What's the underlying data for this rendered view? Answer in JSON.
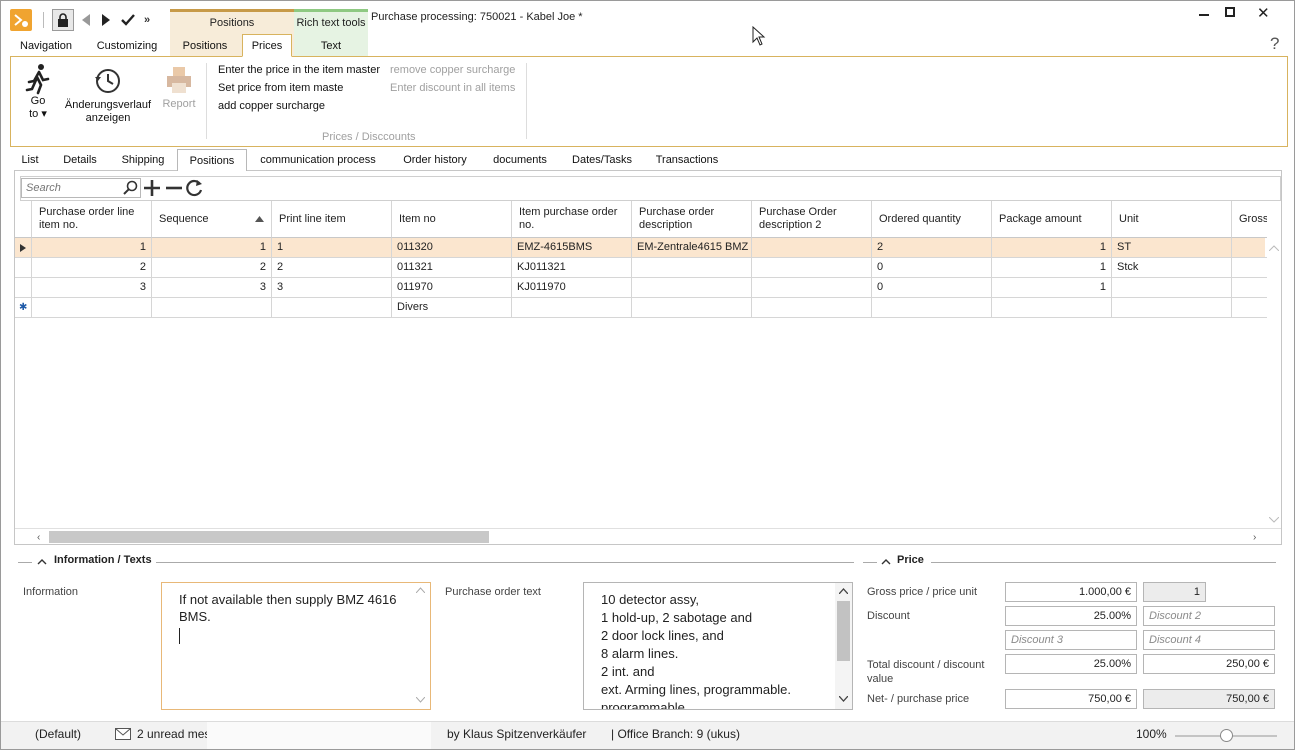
{
  "window": {
    "title": "Purchase processing: 750021 - Kabel Joe *"
  },
  "context_tabs": {
    "group1": "Positions",
    "group2": "Rich text tools"
  },
  "menu_tabs": [
    "Navigation",
    "Customizing",
    "Positions",
    "Prices",
    "Text"
  ],
  "ribbon": {
    "goto": "Go",
    "goto2": "to ▾",
    "history": "Änderungsverlauf",
    "history2": "anzeigen",
    "report": "Report",
    "actions": [
      "Enter the price in the item master",
      "Set price from item maste",
      "add copper surcharge",
      "remove copper surcharge",
      "Enter discount in all items"
    ],
    "group_label": "Prices / Disccounts"
  },
  "tabs": [
    "List",
    "Details",
    "Shipping",
    "Positions",
    "communication process",
    "Order history",
    "documents",
    "Dates/Tasks",
    "Transactions"
  ],
  "search": {
    "placeholder": "Search"
  },
  "grid": {
    "headers": [
      "Purchase order line item no.",
      "Sequence",
      "Print line item",
      "Item no",
      "Item purchase order no.",
      "Purchase order description",
      "Purchase Order description 2",
      "Ordered quantity",
      "Package amount",
      "Unit",
      "Gross"
    ],
    "rows": [
      [
        "1",
        "1",
        "1",
        "011320",
        "EMZ-4615BMS",
        "EM-Zentrale4615 BMZ",
        "",
        "2",
        "1",
        "ST"
      ],
      [
        "2",
        "2",
        "2",
        "011321",
        "KJ011321",
        "",
        "",
        "0",
        "1",
        "Stck"
      ],
      [
        "3",
        "3",
        "3",
        "011970",
        "KJ011970",
        "",
        "",
        "0",
        "1",
        ""
      ],
      [
        "",
        "",
        "",
        "Divers",
        "",
        "",
        "",
        "",
        "",
        ""
      ]
    ]
  },
  "info": {
    "section": "Information / Texts",
    "info_label": "Information",
    "info_text": "If not available then supply BMZ 4616 BMS.",
    "po_text_label": "Purchase order text",
    "po_text_lines": [
      "10 detector assy,",
      "1 hold-up, 2 sabotage and",
      "2 door lock lines, and",
      "8 alarm lines.",
      "2 int. and",
      "ext. Arming lines, programmable.",
      "programmable"
    ]
  },
  "price": {
    "section": "Price",
    "gross_label": "Gross price / price unit",
    "gross_value": "1.000,00 €",
    "price_unit": "1",
    "discount_label": "Discount",
    "discount1": "25.00%",
    "discount2": "Discount 2",
    "discount3": "Discount 3",
    "discount4": "Discount 4",
    "total_label": "Total discount / discount value",
    "total_pct": "25.00%",
    "total_value": "250,00 €",
    "net_label": "Net- / purchase price",
    "net1": "750,00 €",
    "net2": "750,00 €"
  },
  "status": {
    "profile": "(Default)",
    "unread": "2 unread mes",
    "by": "by Klaus Spitzenverkäufer",
    "branch": "| Office Branch:  9 (ukus)",
    "zoom": "100%",
    "zoom_level": 0.5
  }
}
